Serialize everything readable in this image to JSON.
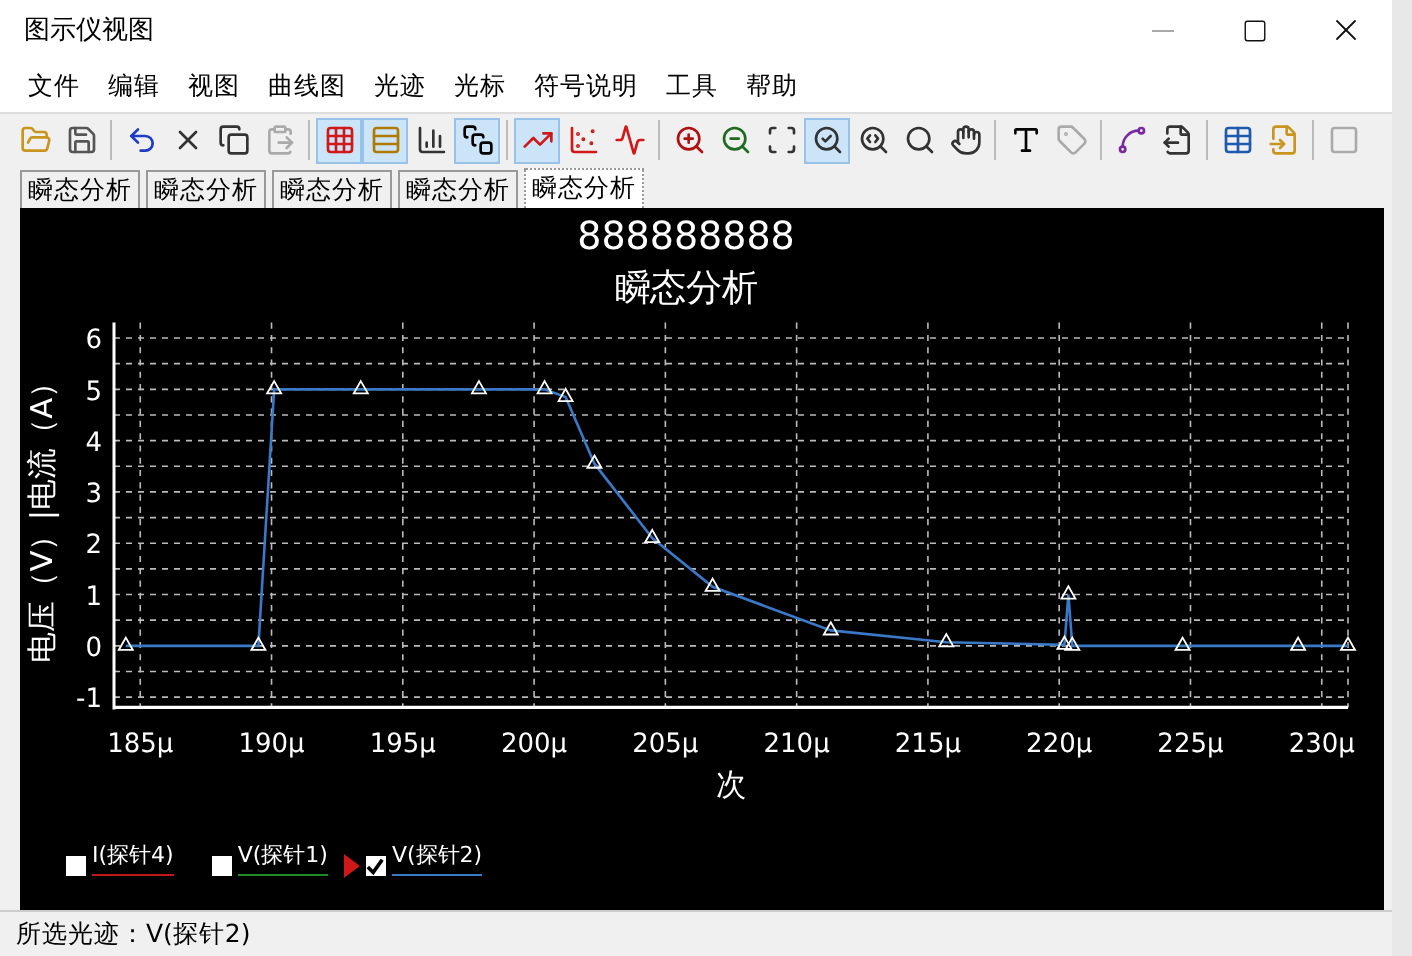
{
  "window": {
    "title": "图示仪视图"
  },
  "menu": [
    "文件",
    "编辑",
    "视图",
    "曲线图",
    "光迹",
    "光标",
    "符号说明",
    "工具",
    "帮助"
  ],
  "toolbar": [
    [
      {
        "kind": "open",
        "selected": false,
        "disabled": false
      },
      {
        "kind": "save",
        "selected": false,
        "disabled": false
      }
    ],
    [
      {
        "kind": "undo",
        "selected": false,
        "disabled": false
      },
      {
        "kind": "delete",
        "selected": false,
        "disabled": false
      },
      {
        "kind": "copy",
        "selected": false,
        "disabled": false
      },
      {
        "kind": "paste",
        "selected": false,
        "disabled": true
      }
    ],
    [
      {
        "kind": "grid",
        "selected": true,
        "disabled": false
      },
      {
        "kind": "legend",
        "selected": true,
        "disabled": false
      },
      {
        "kind": "axes",
        "selected": false,
        "disabled": false
      },
      {
        "kind": "background",
        "selected": true,
        "disabled": false
      }
    ],
    [
      {
        "kind": "lines",
        "selected": true,
        "disabled": false
      },
      {
        "kind": "points",
        "selected": false,
        "disabled": false
      },
      {
        "kind": "line-points",
        "selected": false,
        "disabled": false
      }
    ],
    [
      {
        "kind": "zoom-in",
        "selected": false,
        "disabled": false
      },
      {
        "kind": "zoom-out",
        "selected": false,
        "disabled": false
      },
      {
        "kind": "zoom-area",
        "selected": false,
        "disabled": false
      },
      {
        "kind": "zoom-fit",
        "selected": true,
        "disabled": false
      },
      {
        "kind": "zoom-x",
        "selected": false,
        "disabled": false
      },
      {
        "kind": "zoom-y",
        "selected": false,
        "disabled": false
      },
      {
        "kind": "pan",
        "selected": false,
        "disabled": false
      }
    ],
    [
      {
        "kind": "text",
        "selected": false,
        "disabled": false
      },
      {
        "kind": "label",
        "selected": false,
        "disabled": true
      }
    ],
    [
      {
        "kind": "cursors",
        "selected": false,
        "disabled": false
      },
      {
        "kind": "export",
        "selected": false,
        "disabled": false
      }
    ],
    [
      {
        "kind": "export-data",
        "selected": false,
        "disabled": false
      },
      {
        "kind": "import",
        "selected": false,
        "disabled": false
      }
    ],
    [
      {
        "kind": "stop",
        "selected": false,
        "disabled": true
      }
    ]
  ],
  "tabs": [
    {
      "label": "瞬态分析",
      "selected": false
    },
    {
      "label": "瞬态分析",
      "selected": false
    },
    {
      "label": "瞬态分析",
      "selected": false
    },
    {
      "label": "瞬态分析",
      "selected": false
    },
    {
      "label": "瞬态分析",
      "selected": true
    }
  ],
  "chart": {
    "chart_data": {
      "type": "line",
      "title": "888888888",
      "subtitle": "瞬态分析",
      "xlabel": "次",
      "ylabel": "电压（V）|电流（A）",
      "x": [
        184.45,
        189.5,
        190.1,
        193.4,
        197.9,
        200.4,
        201.2,
        202.3,
        204.5,
        206.8,
        211.3,
        215.7,
        220.2,
        220.35,
        220.5,
        224.7,
        229.1,
        231
      ],
      "series": [
        {
          "name": "I(探针4)",
          "color": "#c01818",
          "values": [
            null,
            null,
            null,
            null,
            null,
            null,
            null,
            null,
            null,
            null,
            null,
            null,
            null,
            null,
            null,
            null,
            null,
            null
          ]
        },
        {
          "name": "V(探针1)",
          "color": "#1f8a2a",
          "values": [
            null,
            null,
            null,
            null,
            null,
            null,
            null,
            null,
            null,
            null,
            null,
            null,
            null,
            null,
            null,
            null,
            null,
            null
          ]
        },
        {
          "name": "V(探针2)",
          "color": "#3a78c8",
          "marker": "triangle",
          "values": [
            0,
            0,
            5,
            5,
            5,
            5,
            4.85,
            3.55,
            2.1,
            1.15,
            0.3,
            0.07,
            0.02,
            1.0,
            0,
            0,
            0,
            0
          ]
        }
      ],
      "grid": true,
      "xlim": [
        184,
        231
      ],
      "ylim": [
        -1.2,
        6.3
      ],
      "xticks": [
        {
          "value": 185,
          "label": "185µ"
        },
        {
          "value": 190,
          "label": "190µ"
        },
        {
          "value": 195,
          "label": "195µ"
        },
        {
          "value": 200,
          "label": "200µ"
        },
        {
          "value": 205,
          "label": "205µ"
        },
        {
          "value": 210,
          "label": "210µ"
        },
        {
          "value": 215,
          "label": "215µ"
        },
        {
          "value": 220,
          "label": "220µ"
        },
        {
          "value": 225,
          "label": "225µ"
        },
        {
          "value": 230,
          "label": "230µ"
        }
      ],
      "yticks": [
        -1,
        0,
        1,
        2,
        3,
        4,
        5,
        6
      ]
    },
    "legend": [
      {
        "checked": false,
        "selected": false
      },
      {
        "checked": false,
        "selected": false
      },
      {
        "checked": true,
        "selected": true
      }
    ]
  },
  "status_bar": "所选光迹：V(探针2)"
}
